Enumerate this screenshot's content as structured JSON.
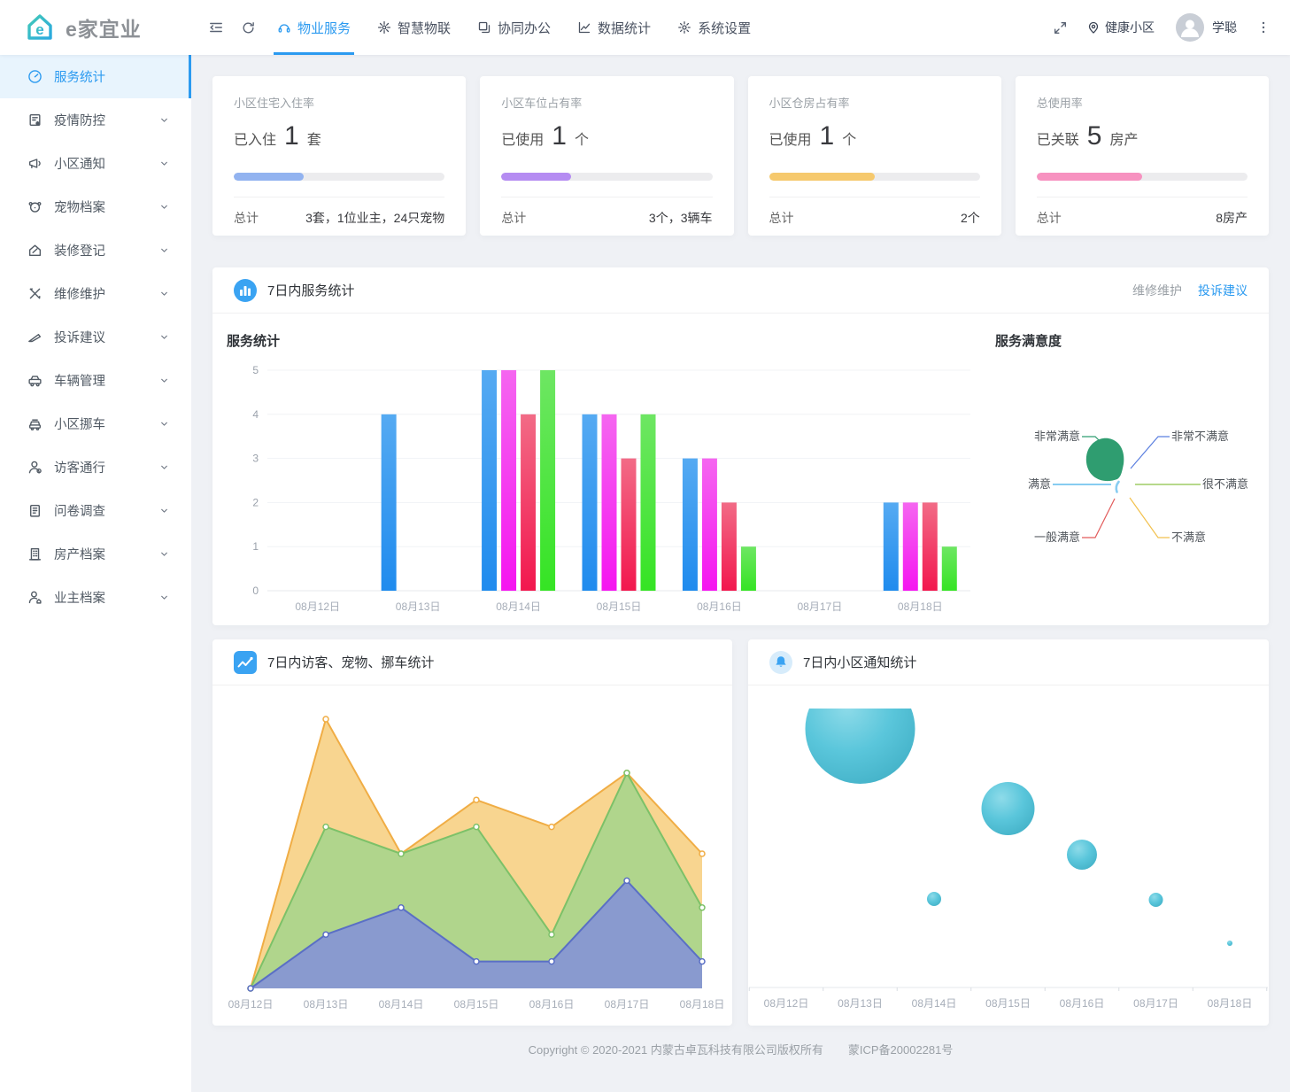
{
  "header": {
    "logo_text": "e家宜业",
    "nav_items": [
      {
        "name": "tab-property-service",
        "label": "物业服务",
        "icon": "headset-icon",
        "active": true
      },
      {
        "name": "tab-smart-iot",
        "label": "智慧物联",
        "icon": "iot-icon",
        "active": false
      },
      {
        "name": "tab-collab-office",
        "label": "协同办公",
        "icon": "office-icon",
        "active": false
      },
      {
        "name": "tab-data-stats",
        "label": "数据统计",
        "icon": "stats-icon",
        "active": false
      },
      {
        "name": "tab-system-settings",
        "label": "系统设置",
        "icon": "settings-icon",
        "active": false
      }
    ],
    "community_label": "健康小区",
    "username": "学聪"
  },
  "sidebar": {
    "items": [
      {
        "name": "sidebar-item-service-stats",
        "label": "服务统计",
        "icon": "dashboard-icon",
        "active": true,
        "expandable": false
      },
      {
        "name": "sidebar-item-epidemic",
        "label": "疫情防控",
        "icon": "epidemic-icon",
        "active": false,
        "expandable": true
      },
      {
        "name": "sidebar-item-notice",
        "label": "小区通知",
        "icon": "megaphone-icon",
        "active": false,
        "expandable": true
      },
      {
        "name": "sidebar-item-pets",
        "label": "宠物档案",
        "icon": "pet-icon",
        "active": false,
        "expandable": true
      },
      {
        "name": "sidebar-item-renovation",
        "label": "装修登记",
        "icon": "renovation-icon",
        "active": false,
        "expandable": true
      },
      {
        "name": "sidebar-item-repair",
        "label": "维修维护",
        "icon": "repair-icon",
        "active": false,
        "expandable": true
      },
      {
        "name": "sidebar-item-complaints",
        "label": "投诉建议",
        "icon": "complaint-icon",
        "active": false,
        "expandable": true
      },
      {
        "name": "sidebar-item-vehicles",
        "label": "车辆管理",
        "icon": "vehicle-icon",
        "active": false,
        "expandable": true
      },
      {
        "name": "sidebar-item-move-car",
        "label": "小区挪车",
        "icon": "movecar-icon",
        "active": false,
        "expandable": true
      },
      {
        "name": "sidebar-item-visitors",
        "label": "访客通行",
        "icon": "visitor-icon",
        "active": false,
        "expandable": true
      },
      {
        "name": "sidebar-item-survey",
        "label": "问卷调查",
        "icon": "survey-icon",
        "active": false,
        "expandable": true
      },
      {
        "name": "sidebar-item-estate",
        "label": "房产档案",
        "icon": "estate-icon",
        "active": false,
        "expandable": true
      },
      {
        "name": "sidebar-item-owners",
        "label": "业主档案",
        "icon": "owner-icon",
        "active": false,
        "expandable": true
      }
    ]
  },
  "cards": [
    {
      "title": "小区住宅入住率",
      "prefix": "已入住",
      "value": "1",
      "unit": "套",
      "percent": 33,
      "color": "#92b3f0",
      "total_label": "总计",
      "total_value": "3套，1位业主，24只宠物"
    },
    {
      "title": "小区车位占有率",
      "prefix": "已使用",
      "value": "1",
      "unit": "个",
      "percent": 33,
      "color": "#b58cf2",
      "total_label": "总计",
      "total_value": "3个，3辆车"
    },
    {
      "title": "小区仓房占有率",
      "prefix": "已使用",
      "value": "1",
      "unit": "个",
      "percent": 50,
      "color": "#f6c96d",
      "total_label": "总计",
      "total_value": "2个"
    },
    {
      "title": "总使用率",
      "prefix": "已关联",
      "value": "5",
      "unit": "房产",
      "percent": 50,
      "color": "#f792c0",
      "total_label": "总计",
      "total_value": "8房产"
    }
  ],
  "panels": {
    "service": {
      "title": "7日内服务统计",
      "badge": "barchart-badge",
      "link_secondary": "维修维护",
      "link_primary": "投诉建议",
      "bar_caption": "服务统计",
      "pie_caption": "服务满意度"
    },
    "visitor": {
      "title": "7日内访客、宠物、挪车统计",
      "badge": "linechart-badge"
    },
    "notice": {
      "title": "7日内小区通知统计",
      "badge": "bell-badge"
    }
  },
  "footer": {
    "copyright": "Copyright © 2020-2021 内蒙古卓瓦科技有限公司版权所有",
    "icp": "蒙ICP备20002281号"
  },
  "chart_data": [
    {
      "id": "service-bars",
      "type": "bar",
      "title": "服务统计",
      "categories": [
        "08月12日",
        "08月13日",
        "08月14日",
        "08月15日",
        "08月16日",
        "08月17日",
        "08月18日"
      ],
      "series": [
        {
          "name": "series-blue",
          "color_top": "#55aaf2",
          "color_bottom": "#1f8bee",
          "values": [
            0,
            4,
            5,
            4,
            3,
            0,
            2
          ]
        },
        {
          "name": "series-magenta",
          "color_top": "#f566f0",
          "color_bottom": "#f515f0",
          "values": [
            0,
            0,
            5,
            4,
            3,
            0,
            2
          ]
        },
        {
          "name": "series-red",
          "color_top": "#f26b86",
          "color_bottom": "#f2174e",
          "values": [
            0,
            0,
            4,
            3,
            2,
            0,
            2
          ]
        },
        {
          "name": "series-green",
          "color_top": "#6ee663",
          "color_bottom": "#35e424",
          "values": [
            0,
            0,
            5,
            4,
            1,
            0,
            1
          ]
        }
      ],
      "ylim": [
        0,
        5
      ],
      "yticks": [
        0,
        1,
        2,
        3,
        4,
        5
      ],
      "grid": true,
      "legend": "none"
    },
    {
      "id": "satisfaction-pie",
      "type": "pie",
      "title": "服务满意度",
      "slices": [
        {
          "label": "非常满意",
          "color": "#2f9d70",
          "value": 9
        },
        {
          "label": "满意",
          "color": "#87ccf1",
          "value": 1
        },
        {
          "label": "一般满意",
          "color": "#e25b5b",
          "value": 0
        },
        {
          "label": "不满意",
          "color": "#f2c14e",
          "value": 0
        },
        {
          "label": "很不满意",
          "color": "#b7d98b",
          "value": 0
        },
        {
          "label": "非常不满意",
          "color": "#5b7fe0",
          "value": 0
        }
      ],
      "legend": "none"
    },
    {
      "id": "visitor-pet-movecar-area",
      "type": "area",
      "categories": [
        "08月12日",
        "08月13日",
        "08月14日",
        "08月15日",
        "08月16日",
        "08月17日",
        "08月18日"
      ],
      "series": [
        {
          "name": "访客",
          "line": "#f0ad45",
          "fill": "rgba(246,202,116,0.8)",
          "values": [
            0,
            10,
            5,
            7,
            6,
            8,
            5
          ]
        },
        {
          "name": "宠物",
          "line": "#7cc168",
          "fill": "rgba(163,213,140,0.85)",
          "values": [
            0,
            6,
            5,
            6,
            2,
            8,
            3
          ]
        },
        {
          "name": "挪车",
          "line": "#5a6fc5",
          "fill": "rgba(133,147,214,0.9)",
          "values": [
            0,
            2,
            3,
            1,
            1,
            4,
            1
          ]
        }
      ],
      "ylim": [
        0,
        10
      ],
      "grid": false,
      "legend": "none"
    },
    {
      "id": "notice-bubbles",
      "type": "scatter",
      "categories": [
        "08月12日",
        "08月13日",
        "08月14日",
        "08月15日",
        "08月16日",
        "08月17日",
        "08月18日"
      ],
      "color": "#57c5da",
      "points": [
        {
          "date": "08月13日",
          "value": 10,
          "y": 49,
          "r": 62
        },
        {
          "date": "08月14日",
          "value": 2,
          "y": 241,
          "r": 8
        },
        {
          "date": "08月15日",
          "value": 6,
          "y": 139,
          "r": 30
        },
        {
          "date": "08月16日",
          "value": 4,
          "y": 191,
          "r": 17
        },
        {
          "date": "08月17日",
          "value": 2,
          "y": 242,
          "r": 8
        },
        {
          "date": "08月18日",
          "value": 1,
          "y": 291,
          "r": 3
        }
      ]
    }
  ]
}
